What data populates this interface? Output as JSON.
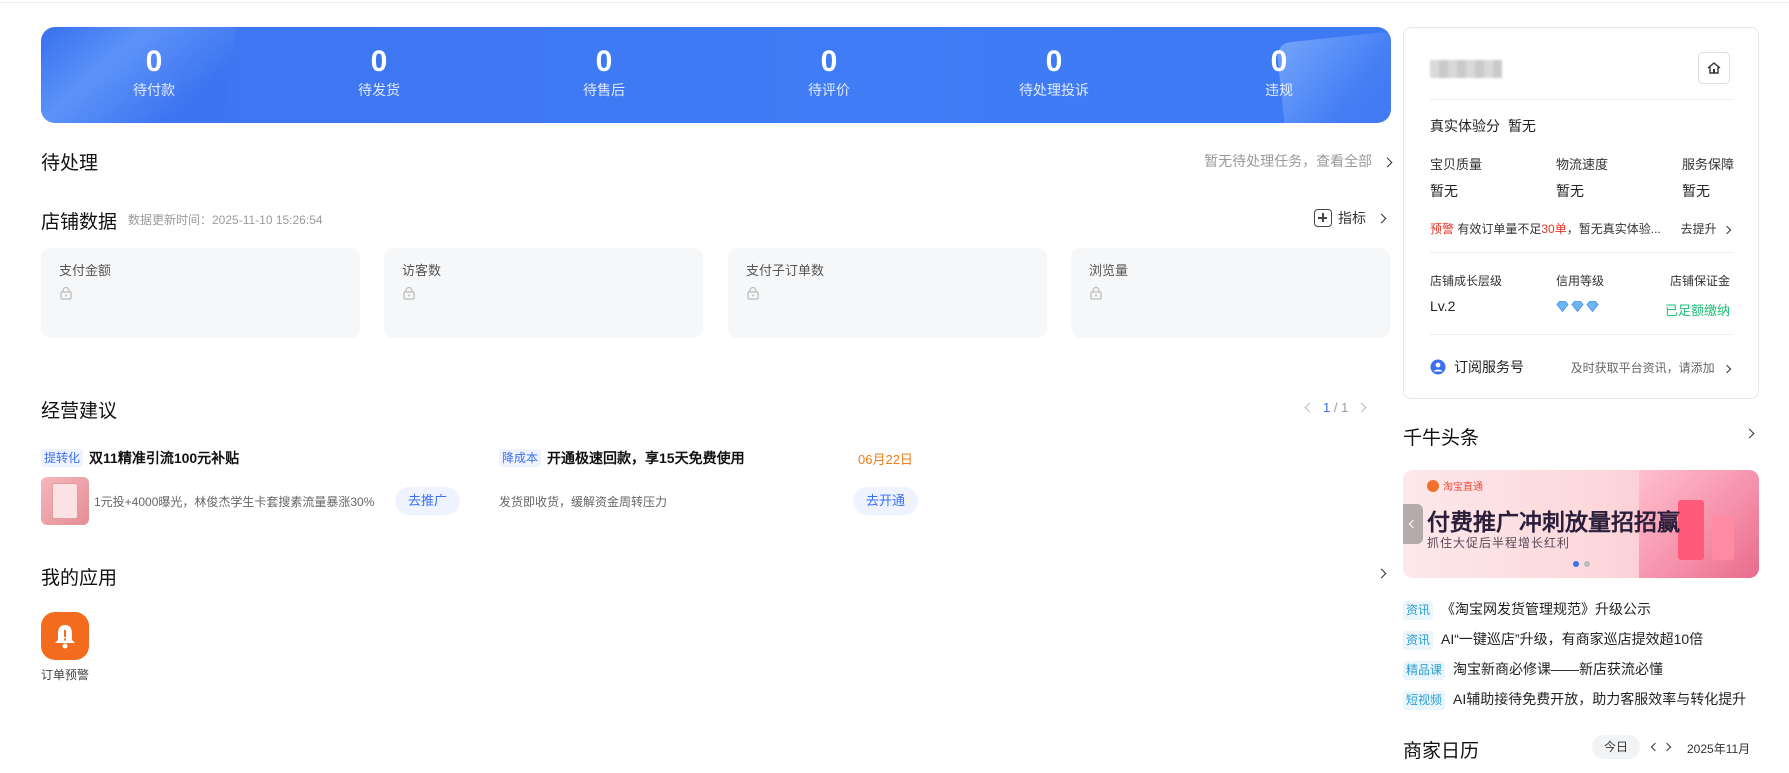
{
  "stats": [
    {
      "value": "0",
      "label": "待付款"
    },
    {
      "value": "0",
      "label": "待发货"
    },
    {
      "value": "0",
      "label": "待售后"
    },
    {
      "value": "0",
      "label": "待评价"
    },
    {
      "value": "0",
      "label": "待处理投诉"
    },
    {
      "value": "0",
      "label": "违规"
    }
  ],
  "pending": {
    "title": "待处理",
    "link": "暂无待处理任务，查看全部"
  },
  "store_data": {
    "title": "店铺数据",
    "update_time": "数据更新时间：2025-11-10 15:26:54",
    "metric_button": "指标",
    "cards": [
      "支付金额",
      "访客数",
      "支付子订单数",
      "浏览量"
    ]
  },
  "advice": {
    "title": "经营建议",
    "pager_current": "1",
    "pager_sep": "/",
    "pager_total": "1",
    "items": [
      {
        "tag": "提转化",
        "title": "双11精准引流100元补贴",
        "desc": "1元投+4000曝光，林俊杰学生卡套搜素流量暴涨30%",
        "button": "去推广"
      },
      {
        "tag": "降成本",
        "title": "开通极速回款，享15天免费使用",
        "date": "06月22日",
        "desc": "发货即收货，缓解资金周转压力",
        "button": "去开通"
      }
    ]
  },
  "my_apps": {
    "title": "我的应用",
    "apps": [
      {
        "label": "订单预警",
        "icon": "bell-warning-icon"
      }
    ]
  },
  "shop_panel": {
    "score_label": "真实体验分",
    "score_value": "暂无",
    "metrics": [
      {
        "label": "宝贝质量",
        "value": "暂无"
      },
      {
        "label": "物流速度",
        "value": "暂无"
      },
      {
        "label": "服务保障",
        "value": "暂无"
      }
    ],
    "warning_tag": "预警",
    "warning_text_1": "有效订单量不足",
    "warning_highlight": "30单",
    "warning_text_2": "，暂无真实体验...",
    "warning_link": "去提升",
    "growth_label": "店铺成长层级",
    "growth_value": "Lv.2",
    "credit_label": "信用等级",
    "deposit_label": "店铺保证金",
    "deposit_value": "已足额缴纳",
    "subscribe_label": "订阅服务号",
    "subscribe_desc": "及时获取平台资讯，请添加"
  },
  "headlines": {
    "title": "千牛头条",
    "banner_logo": "淘宝直通",
    "banner_title": "付费推广冲刺放量招招赢",
    "banner_subtitle": "抓住大促后半程增长红利",
    "news": [
      {
        "tag": "资讯",
        "text": "《淘宝网发货管理规范》升级公示"
      },
      {
        "tag": "资讯",
        "text": "AI“一键巡店”升级，有商家巡店提效超10倍"
      },
      {
        "tag": "精品课",
        "text": "淘宝新商必修课——新店获流必懂"
      },
      {
        "tag": "短视频",
        "text": "AI辅助接待免费开放，助力客服效率与转化提升"
      }
    ]
  },
  "calendar": {
    "title": "商家日历",
    "today_button": "今日",
    "month": "2025年11月"
  },
  "colors": {
    "accent": "#3d79f3",
    "warning": "#e8352b",
    "orange": "#f07d1a",
    "green": "#1fbf75"
  }
}
